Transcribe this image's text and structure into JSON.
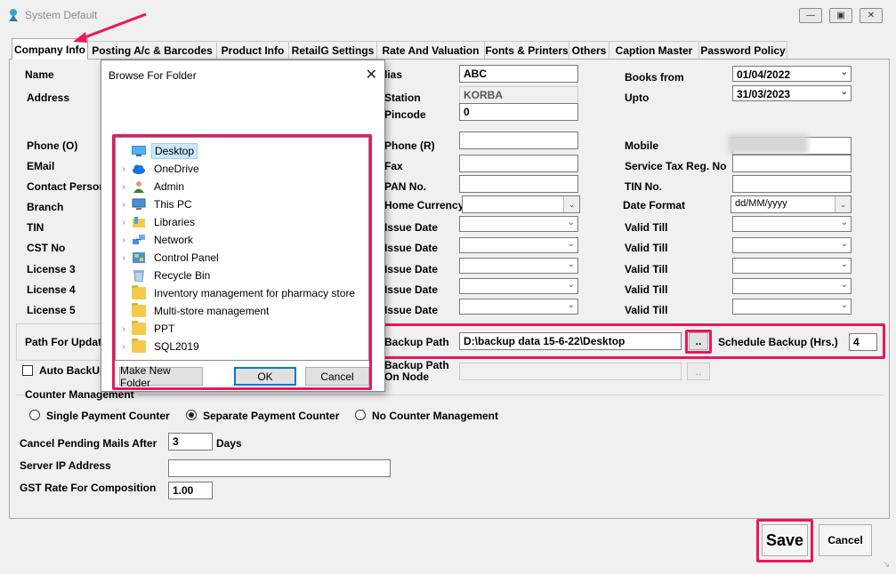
{
  "window": {
    "title": "System Default"
  },
  "tabs": [
    "Company Info",
    "Posting A/c & Barcodes",
    "Product Info",
    "RetailG Settings",
    "Rate And Valuation",
    "Fonts & Printers",
    "Others",
    "Caption Master",
    "Password Policy"
  ],
  "left_labels": {
    "name": "Name",
    "address": "Address",
    "phone_o": "Phone (O)",
    "email": "EMail",
    "contact_person": "Contact Person",
    "branch": "Branch",
    "tin": "TIN",
    "cst_no": "CST No",
    "license3": "License 3",
    "license4": "License 4",
    "license5": "License 5",
    "path_for_update": "Path For Updat",
    "auto_backup": "Auto BackUp"
  },
  "middle": {
    "alias_label": "lias",
    "alias_value": "ABC",
    "station_label": "Station",
    "station_value": "KORBA",
    "pincode_label": "Pincode",
    "pincode_value": "0",
    "phone_r_label": "Phone (R)",
    "fax_label": "Fax",
    "pan_label": "PAN No.",
    "home_currency_label": "Home Currency",
    "issue_date_label": "Issue Date",
    "backup_path_label": "Backup Path",
    "backup_path_value": "D:\\backup data 15-6-22\\Desktop",
    "browse_label": "..",
    "backup_path_node_label1": "Backup Path",
    "backup_path_node_label2": "On Node",
    "schedule_backup_label": "Schedule Backup (Hrs.)",
    "schedule_backup_value": "4"
  },
  "right": {
    "books_from_label": "Books from",
    "books_from_value": "01/04/2022",
    "upto_label": "Upto",
    "upto_value": "31/03/2023",
    "mobile_label": "Mobile",
    "service_tax_label": "Service Tax Reg. No",
    "tin_no_label": "TIN No.",
    "date_format_label": "Date Format",
    "date_format_value": "dd/MM/yyyy",
    "valid_till_label": "Valid Till"
  },
  "counter": {
    "group_label": "Counter Management",
    "options": [
      "Single Payment Counter",
      "Separate Payment Counter",
      "No Counter Management"
    ],
    "selected": "Separate Payment Counter"
  },
  "bottom": {
    "cancel_pending_label": "Cancel Pending Mails After",
    "cancel_pending_value": "3",
    "days_label": "Days",
    "server_ip_label": "Server IP Address",
    "server_ip_value": "",
    "gst_rate_label": "GST Rate For Composition",
    "gst_rate_value": "1.00"
  },
  "actions": {
    "save": "Save",
    "cancel": "Cancel"
  },
  "dialog": {
    "title": "Browse For Folder",
    "tree": [
      {
        "label": "Desktop",
        "icon": "desktop-icon",
        "expandable": false,
        "selected": true
      },
      {
        "label": "OneDrive",
        "icon": "cloud-icon",
        "expandable": true
      },
      {
        "label": "Admin",
        "icon": "user-icon",
        "expandable": true
      },
      {
        "label": "This PC",
        "icon": "computer-icon",
        "expandable": true
      },
      {
        "label": "Libraries",
        "icon": "library-icon",
        "expandable": true
      },
      {
        "label": "Network",
        "icon": "network-icon",
        "expandable": true
      },
      {
        "label": "Control Panel",
        "icon": "control-panel-icon",
        "expandable": true
      },
      {
        "label": "Recycle Bin",
        "icon": "recycle-bin-icon",
        "expandable": false
      },
      {
        "label": "Inventory management for pharmacy store",
        "icon": "folder-icon",
        "expandable": false
      },
      {
        "label": "Multi-store management",
        "icon": "folder-icon",
        "expandable": false
      },
      {
        "label": "PPT",
        "icon": "folder-icon",
        "expandable": true
      },
      {
        "label": "SQL2019",
        "icon": "folder-icon",
        "expandable": true
      }
    ],
    "make_new_folder": "Make New Folder",
    "ok": "OK",
    "cancel": "Cancel"
  },
  "colors": {
    "highlight": "#e8185a",
    "selection": "#cce8ff",
    "focus": "#0078d7"
  }
}
